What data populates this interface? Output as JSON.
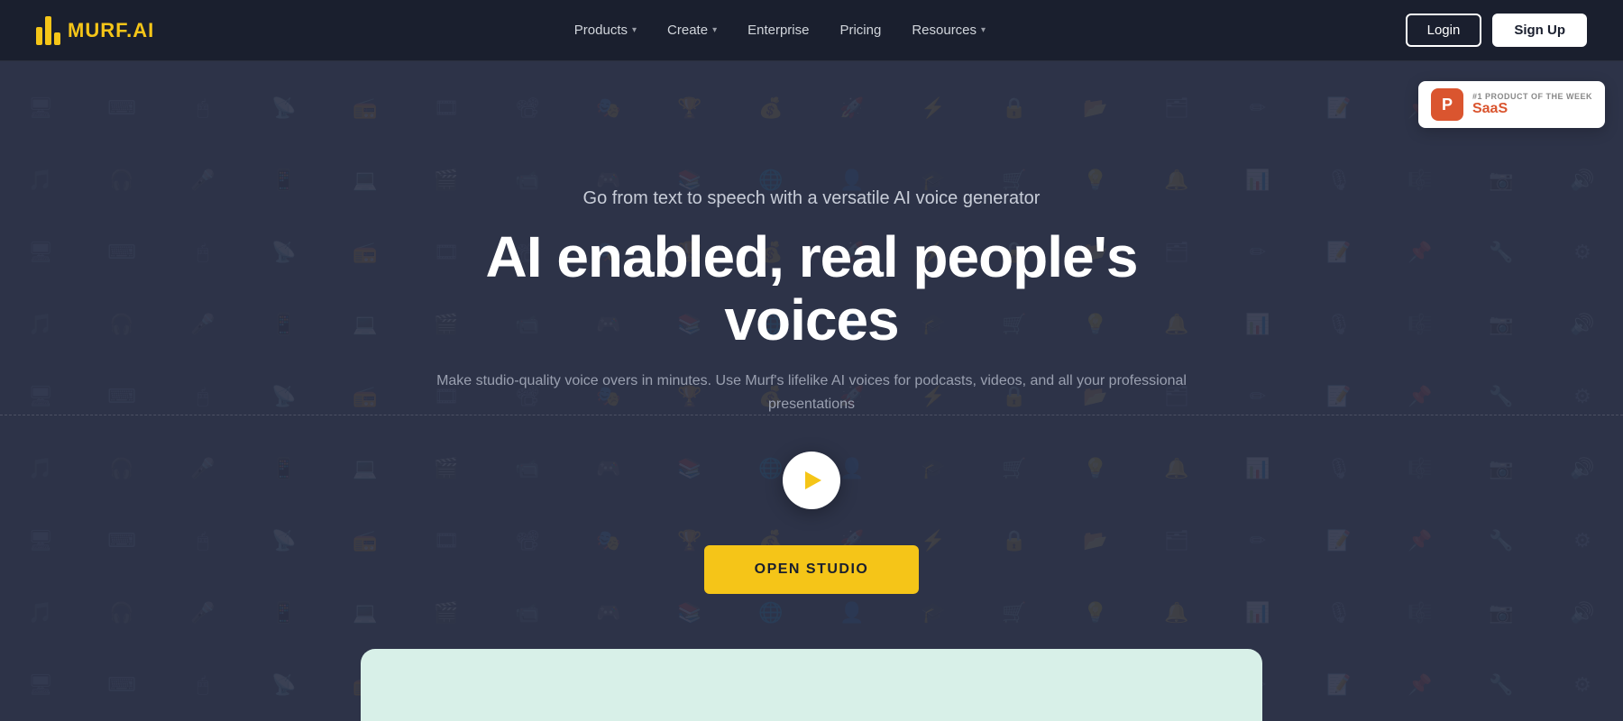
{
  "navbar": {
    "logo_text": "MURF",
    "logo_suffix": ".AI",
    "nav_items": [
      {
        "label": "Products",
        "has_chevron": true
      },
      {
        "label": "Create",
        "has_chevron": true
      },
      {
        "label": "Enterprise",
        "has_chevron": false
      },
      {
        "label": "Pricing",
        "has_chevron": false
      },
      {
        "label": "Resources",
        "has_chevron": true
      }
    ],
    "login_label": "Login",
    "signup_label": "Sign Up"
  },
  "hero": {
    "subtitle": "Go from text to speech with a versatile AI voice generator",
    "title": "AI enabled, real people's voices",
    "description": "Make studio-quality voice overs in minutes. Use Murf's lifelike AI voices for podcasts, videos, and all your professional presentations",
    "cta_label": "OPEN STUDIO"
  },
  "product_hunt": {
    "rank_text": "#1 PRODUCT OF THE WEEK",
    "category": "SaaS",
    "logo_letter": "P"
  },
  "icons": [
    "🎵",
    "🎧",
    "🎤",
    "📱",
    "💻",
    "🎬",
    "📹",
    "🎮",
    "📚",
    "🌐",
    "👤",
    "🎓",
    "🛒",
    "💡",
    "🔔",
    "📊",
    "🎙",
    "🎼",
    "📷",
    "🔊"
  ]
}
